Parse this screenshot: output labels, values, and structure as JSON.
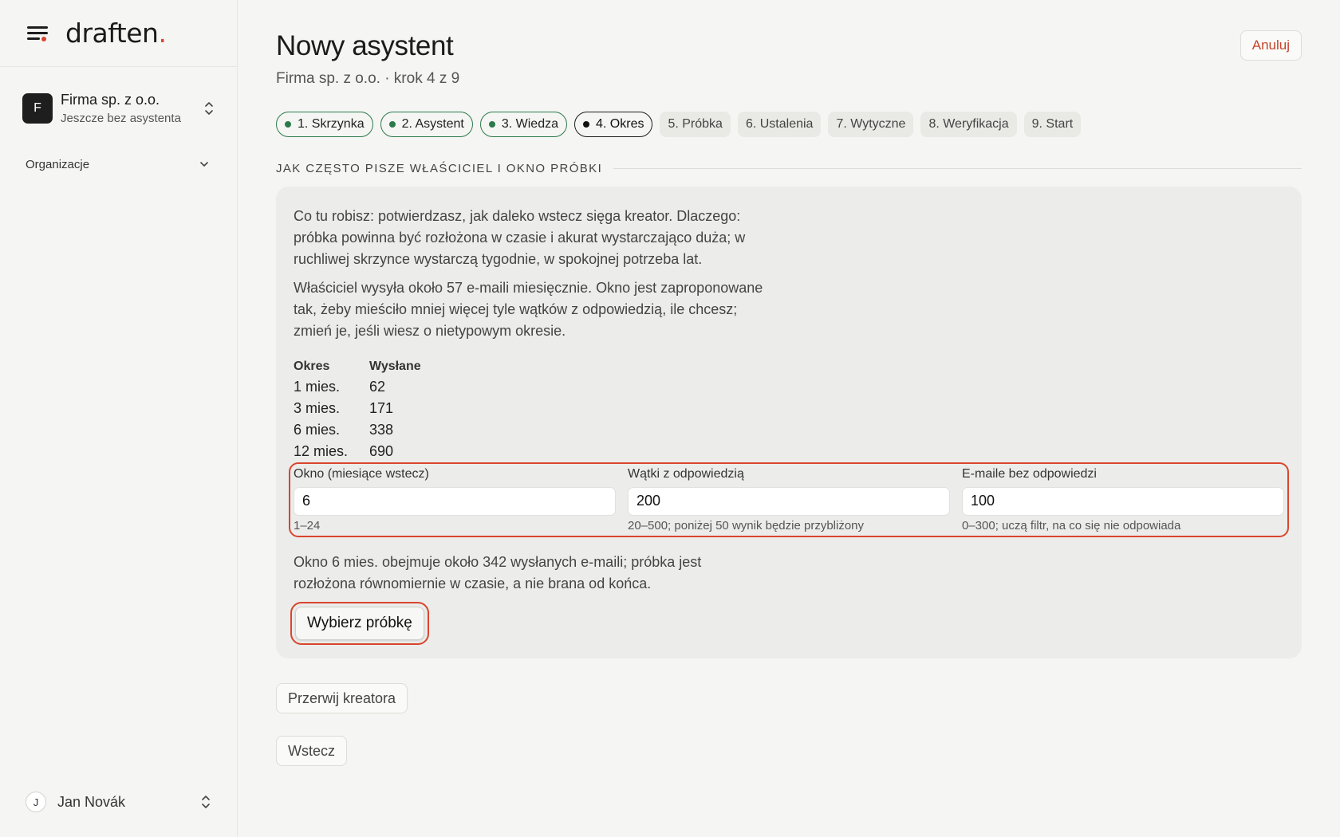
{
  "brand": {
    "name": "draften",
    "dot": "."
  },
  "org": {
    "initial": "F",
    "name": "Firma sp. z o.o.",
    "status": "Jeszcze bez asystenta"
  },
  "nav": {
    "organizations": "Organizacje"
  },
  "user": {
    "initial": "J",
    "name": "Jan Novák"
  },
  "header": {
    "title": "Nowy asystent",
    "subtitle": "Firma sp. z o.o. · krok 4 z 9",
    "cancel": "Anuluj"
  },
  "steps": [
    {
      "label": "1. Skrzynka",
      "state": "done"
    },
    {
      "label": "2. Asystent",
      "state": "done"
    },
    {
      "label": "3. Wiedza",
      "state": "done"
    },
    {
      "label": "4. Okres",
      "state": "current"
    },
    {
      "label": "5. Próbka",
      "state": "todo"
    },
    {
      "label": "6. Ustalenia",
      "state": "todo"
    },
    {
      "label": "7. Wytyczne",
      "state": "todo"
    },
    {
      "label": "8. Weryfikacja",
      "state": "todo"
    },
    {
      "label": "9. Start",
      "state": "todo"
    }
  ],
  "section": {
    "heading": "JAK CZĘSTO PISZE WŁAŚCICIEL I OKNO PRÓBKI",
    "intro": "Co tu robisz: potwierdzasz, jak daleko wstecz sięga kreator. Dlaczego: próbka powinna być rozłożona w czasie i akurat wystarczająco duża; w ruchliwej skrzynce wystarczą tygodnie, w spokojnej potrzeba lat.",
    "explanation": "Właściciel wysyła około 57 e-maili miesięcznie. Okno jest zaproponowane tak, żeby mieściło mniej więcej tyle wątków z odpowiedzią, ile chcesz; zmień je, jeśli wiesz o nietypowym okresie.",
    "table": {
      "headers": [
        "Okres",
        "Wysłane"
      ],
      "rows": [
        [
          "1 mies.",
          "62"
        ],
        [
          "3 mies.",
          "171"
        ],
        [
          "6 mies.",
          "338"
        ],
        [
          "12 mies.",
          "690"
        ]
      ]
    },
    "fields": [
      {
        "label": "Okno (miesiące wstecz)",
        "value": "6",
        "hint": "1–24"
      },
      {
        "label": "Wątki z odpowiedzią",
        "value": "200",
        "hint": "20–500; poniżej 50 wynik będzie przybliżony"
      },
      {
        "label": "E-maile bez odpowiedzi",
        "value": "100",
        "hint": "0–300; uczą filtr, na co się nie odpowiada"
      }
    ],
    "note": "Okno 6 mies. obejmuje około 342 wysłanych e-maili; próbka jest rozłożona równomiernie w czasie, a nie brana od końca.",
    "primary_button": "Wybierz próbkę"
  },
  "footer_buttons": {
    "abort": "Przerwij kreatora",
    "back": "Wstecz"
  },
  "colors": {
    "accent": "#d9452e",
    "done": "#2b7a4b",
    "background": "#f5f5f3"
  }
}
